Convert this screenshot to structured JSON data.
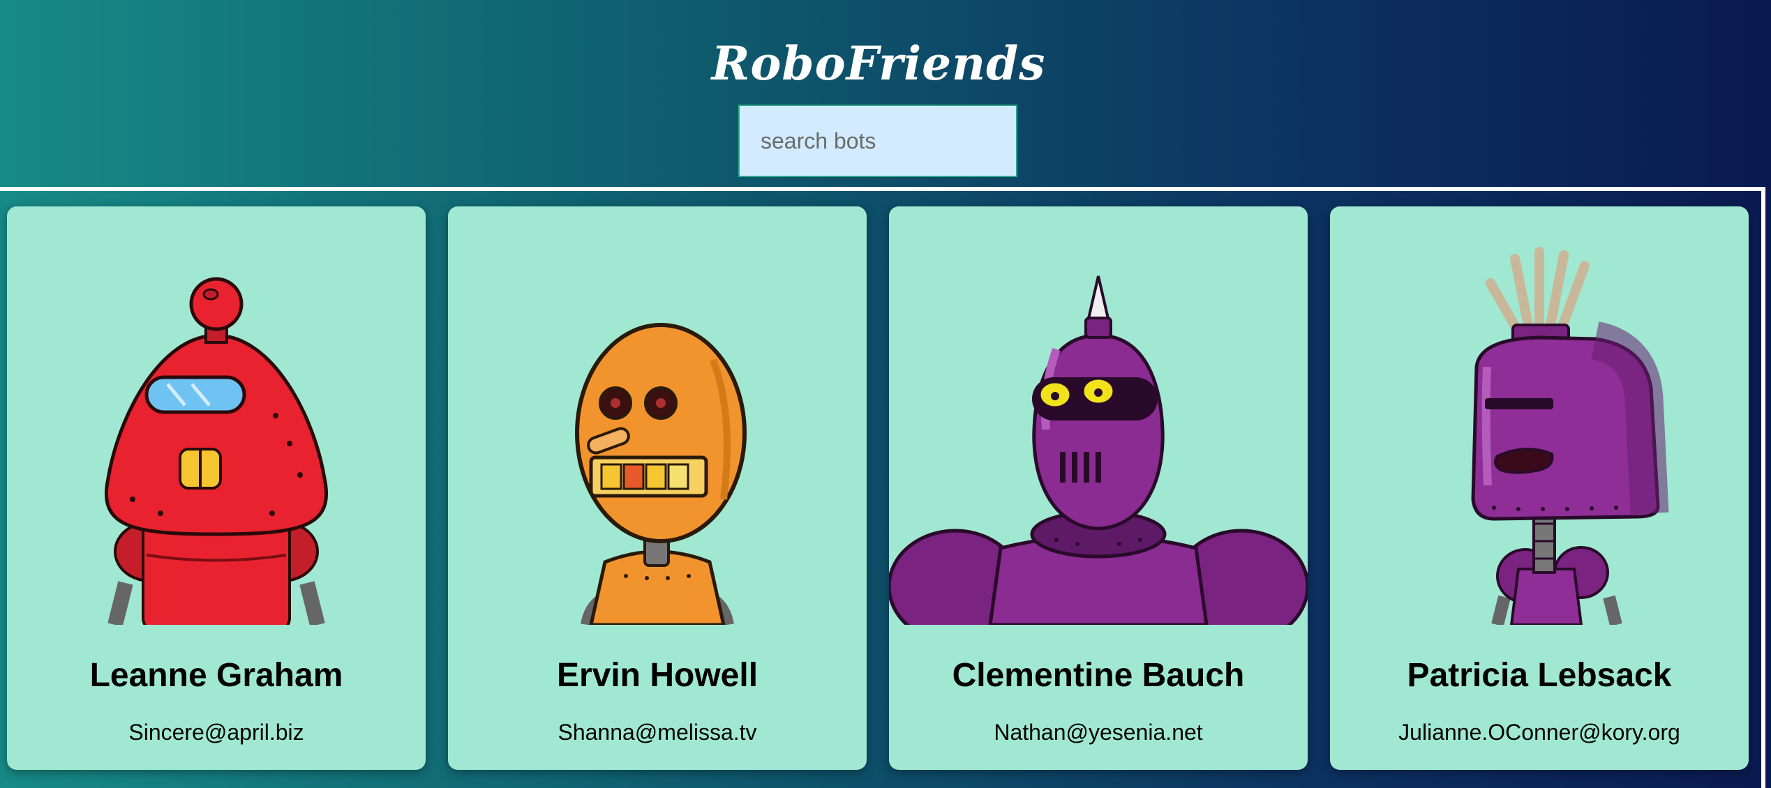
{
  "app": {
    "title": "RoboFriends"
  },
  "search": {
    "placeholder": "search bots"
  },
  "robots": [
    {
      "name": "Leanne Graham",
      "email": "Sincere@april.biz",
      "avatar_icon": "red-robot-avatar",
      "color": "#e8232f"
    },
    {
      "name": "Ervin Howell",
      "email": "Shanna@melissa.tv",
      "avatar_icon": "orange-robot-avatar",
      "color": "#f2942e"
    },
    {
      "name": "Clementine Bauch",
      "email": "Nathan@yesenia.net",
      "avatar_icon": "purple-robot-avatar",
      "color": "#8a2c92"
    },
    {
      "name": "Patricia Lebsack",
      "email": "Julianne.OConner@kory.org",
      "avatar_icon": "purple-robot-avatar",
      "color": "#8e2e96"
    }
  ],
  "colors": {
    "card_background": "#a0e8d1",
    "search_background": "#d3ebff",
    "gradient_start": "#178a86",
    "gradient_end": "#0a1a50"
  }
}
